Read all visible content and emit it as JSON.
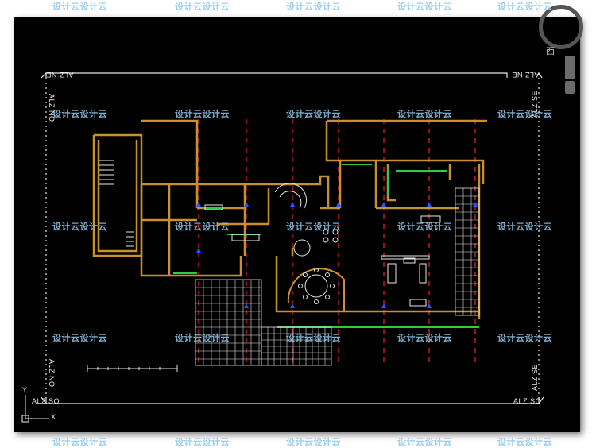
{
  "watermark": "设计云设计云",
  "elevation_labels": {
    "top_left": "ALZ NE",
    "top_right": "ALZ NE",
    "left_top": "ALZ NO",
    "right_top": "ALZ SE",
    "left_bottom": "ALZ NO",
    "right_bottom": "ALZ SE",
    "bottom_left": "ALZ SO",
    "bottom_right": "ALZ SO"
  },
  "viewcube": {
    "direction_label": "西"
  },
  "ucs": {
    "y_label": "Y",
    "x_label": "X"
  },
  "colors": {
    "background": "#000000",
    "walls": "#c8912b",
    "windows": "#2ecc40",
    "axis_lines": "#e0202a",
    "grid": "#e6e6e6",
    "furniture": "#e6e6e6",
    "markers": "#3050ff",
    "watermark": "#8fc7ea"
  }
}
